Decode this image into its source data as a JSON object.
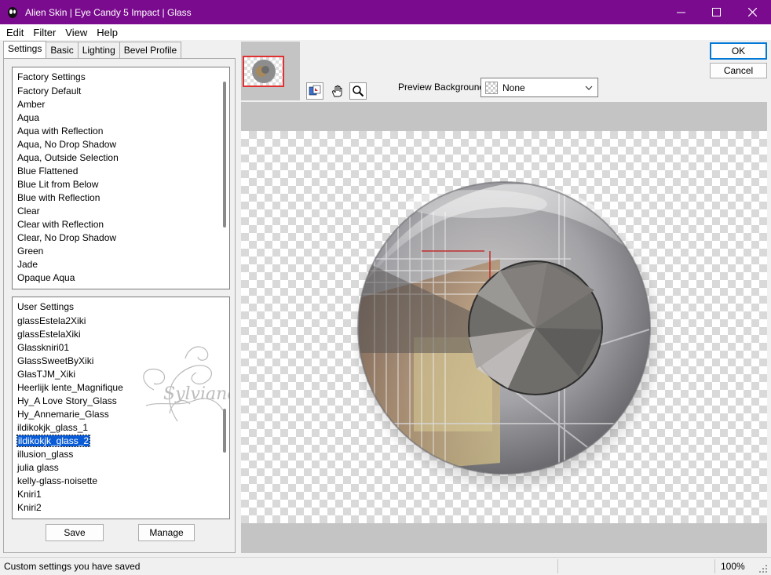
{
  "window": {
    "title": "Alien Skin | Eye Candy 5 Impact | Glass",
    "title_bar_color": "#7a0b8e"
  },
  "menu": [
    "Edit",
    "Filter",
    "View",
    "Help"
  ],
  "tabs": [
    "Settings",
    "Basic",
    "Lighting",
    "Bevel Profile"
  ],
  "factory_settings": {
    "header": "Factory Settings",
    "items": [
      "Factory Default",
      "Amber",
      "Aqua",
      "Aqua with Reflection",
      "Aqua, No Drop Shadow",
      "Aqua, Outside Selection",
      "Blue Flattened",
      "Blue Lit from Below",
      "Blue with Reflection",
      "Clear",
      "Clear with Reflection",
      "Clear, No Drop Shadow",
      "Green",
      "Jade",
      "Opaque Aqua"
    ]
  },
  "user_settings": {
    "header": "User Settings",
    "items": [
      "glassEstela2Xiki",
      "glassEstelaXiki",
      "Glasskniri01",
      "GlassSweetByXiki",
      "GlasTJM_Xiki",
      "Heerlijk lente_Magnifique",
      "Hy_A Love Story_Glass",
      "Hy_Annemarie_Glass",
      "ildikokjk_glass_1",
      "ildikokjk_glass_2",
      "illusion_glass",
      "julia glass",
      "kelly-glass-noisette",
      "Kniri1",
      "Kniri2"
    ],
    "selected": "ildikokjk_glass_2",
    "selection_color": "#0a5cd6"
  },
  "buttons": {
    "save": "Save",
    "manage": "Manage",
    "ok": "OK",
    "cancel": "Cancel"
  },
  "preview_background": {
    "label": "Preview Background:",
    "value": "None"
  },
  "watermark": "Sylviane",
  "status": {
    "message": "Custom settings you have saved",
    "zoom": "100%"
  }
}
